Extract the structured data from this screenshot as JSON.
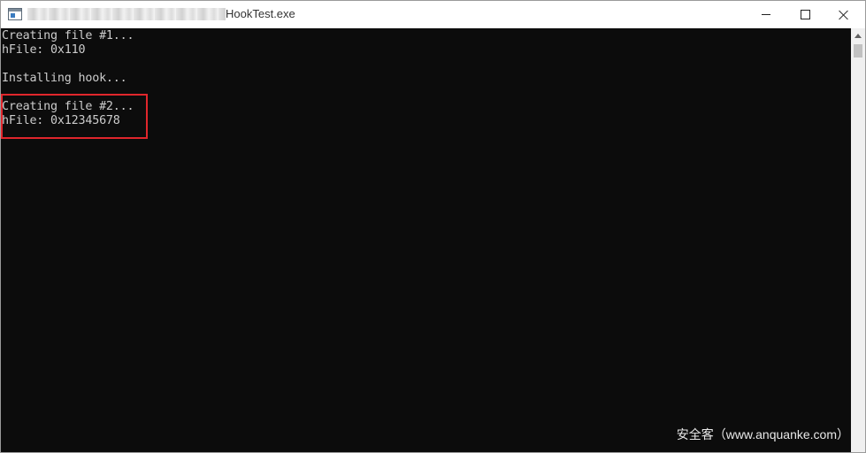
{
  "window": {
    "title": "HookTest.exe"
  },
  "console": {
    "lines": [
      "Creating file #1...",
      "hFile: 0x110",
      "",
      "Installing hook...",
      "",
      "Creating file #2...",
      "hFile: 0x12345678"
    ]
  },
  "watermark": "安全客（www.anquanke.com）",
  "colors": {
    "console_bg": "#0c0c0c",
    "console_text": "#cccccc",
    "highlight_border": "#e0262c"
  },
  "icons": {
    "app": "console-app-icon",
    "minimize": "minimize-icon",
    "maximize": "maximize-icon",
    "close": "close-icon"
  }
}
